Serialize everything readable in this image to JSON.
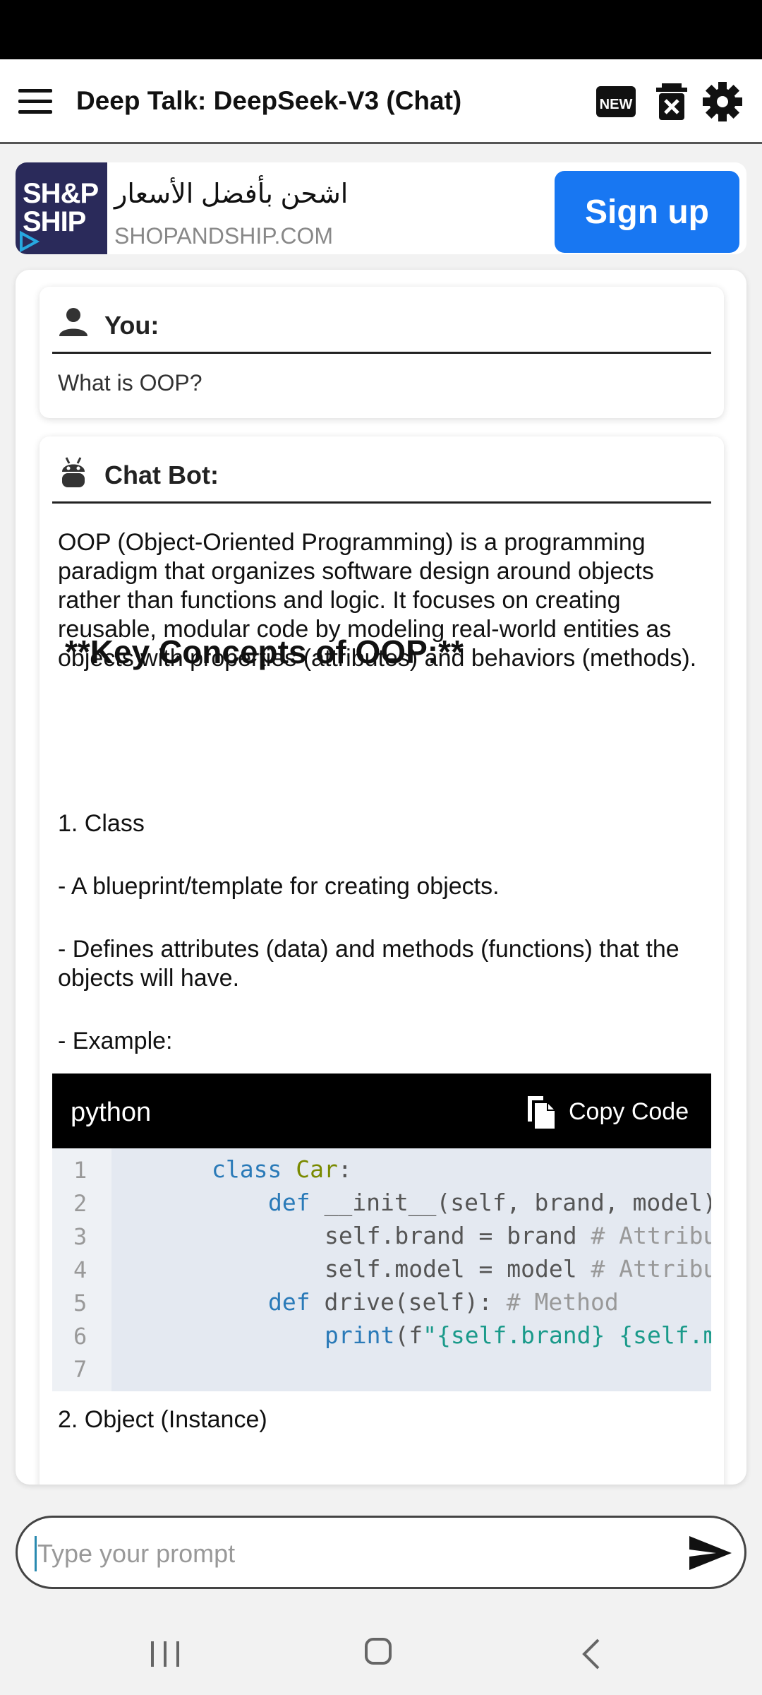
{
  "app": {
    "title": "Deep Talk: DeepSeek-V3 (Chat)",
    "new_badge": "NEW"
  },
  "ad": {
    "logo_line1": "SH&P",
    "logo_line2": "SHIP",
    "headline": "اشحن بأفضل الأسعار",
    "url": "SHOPANDSHIP.COM",
    "cta": "Sign up",
    "brand_color": "#1877f2"
  },
  "chat": {
    "user": {
      "label": "You:",
      "message": "What is OOP?"
    },
    "bot": {
      "label": "Chat Bot:",
      "intro": "OOP (Object-Oriented Programming) is a programming paradigm that organizes software design around objects rather than functions and logic. It focuses on creating reusable, modular code by modeling real-world entities as objects with properties (attributes) and behaviors (methods).",
      "heading": "**Key Concepts of OOP:**",
      "item1": "1. Class",
      "bullet1": "- A blueprint/template for creating objects.",
      "bullet2": "- Defines attributes (data) and methods (functions) that the objects will have.",
      "bullet3": "- Example:",
      "item2": "2. Object (Instance)",
      "code": {
        "language": "python",
        "copy_label": "Copy Code",
        "line_numbers": [
          "1",
          "2",
          "3",
          "4",
          "5",
          "6",
          "7"
        ]
      }
    }
  },
  "composer": {
    "placeholder": "Type your prompt"
  }
}
